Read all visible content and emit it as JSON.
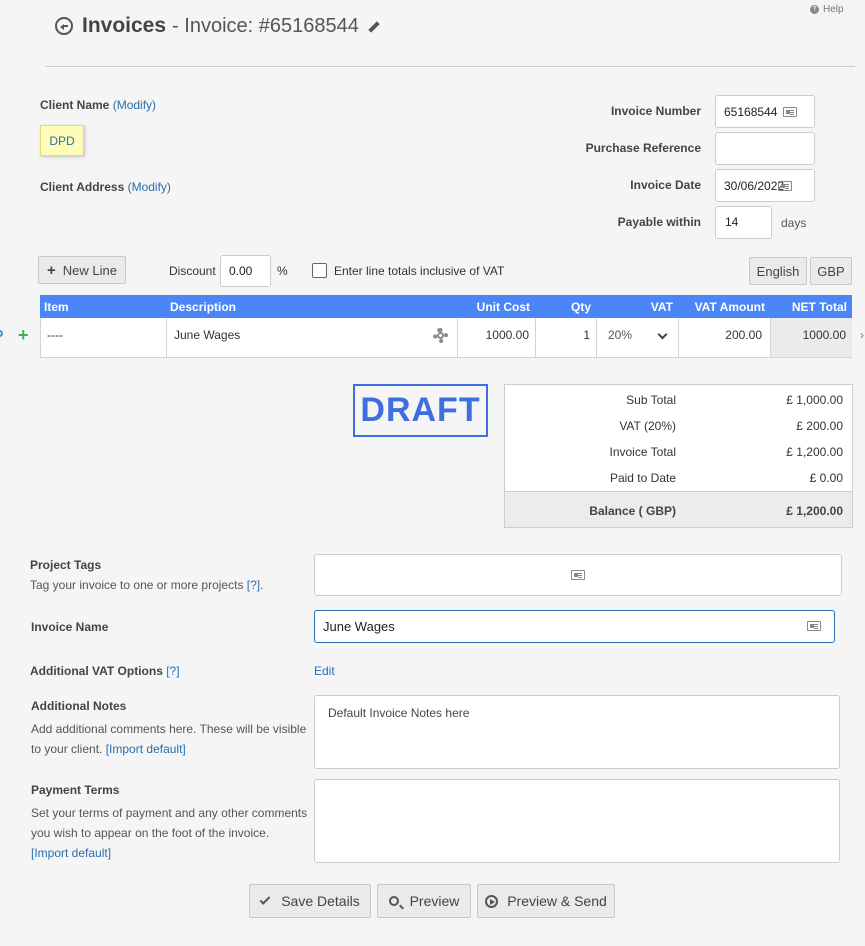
{
  "header": {
    "back_icon": "circle-arrow-left-icon",
    "title": "Invoices",
    "subtitle": "- Invoice: #65168544",
    "edit_icon": "pencil-icon",
    "help": "Help"
  },
  "client": {
    "name_label": "Client Name",
    "modify": "(Modify)",
    "name_value": "DPD",
    "address_label": "Client Address",
    "address_modify": "(Modify)"
  },
  "invoice_meta": {
    "number_label": "Invoice Number",
    "number_value": "65168544",
    "purchase_ref_label": "Purchase Reference",
    "purchase_ref_value": "",
    "date_label": "Invoice Date",
    "date_value": "30/06/2022",
    "payable_label": "Payable within",
    "payable_value": "14",
    "payable_unit": "days"
  },
  "toolbar": {
    "new_line": "New Line",
    "discount_label": "Discount",
    "discount_value": "0.00",
    "discount_unit": "%",
    "vat_inclusive_label": "Enter line totals inclusive of VAT",
    "language": "English",
    "currency": "GBP"
  },
  "table": {
    "headers": [
      "Item",
      "Description",
      "Unit Cost",
      "Qty",
      "VAT",
      "VAT Amount",
      "NET Total"
    ],
    "rows": [
      {
        "item": "----",
        "description": "June Wages",
        "unit_cost": "1000.00",
        "qty": "1",
        "vat": "20%",
        "vat_amount": "200.00",
        "net_total": "1000.00"
      }
    ]
  },
  "status_stamp": "DRAFT",
  "totals": {
    "sub_total_label": "Sub Total",
    "sub_total": "£ 1,000.00",
    "vat_label": "VAT (20%)",
    "vat": "£ 200.00",
    "invoice_total_label": "Invoice Total",
    "invoice_total": "£ 1,200.00",
    "paid_label": "Paid to Date",
    "paid": "£ 0.00",
    "balance_label": "Balance ( GBP)",
    "balance": "£ 1,200.00"
  },
  "project_tags": {
    "label": "Project Tags",
    "help": "Tag your invoice to one or more projects",
    "help_link": "[?]",
    "help_end": "."
  },
  "invoice_name": {
    "label": "Invoice Name",
    "value": "June Wages"
  },
  "vat_options": {
    "label": "Additional VAT Options",
    "help_link": "[?]",
    "edit": "Edit"
  },
  "notes": {
    "label": "Additional Notes",
    "help1": "Add additional comments here. These will be visible",
    "help2": "to your client.",
    "import": "[Import default]",
    "value": "Default Invoice Notes here"
  },
  "terms": {
    "label": "Payment Terms",
    "help1": "Set your terms of payment and any other comments",
    "help2": "you wish to appear on the foot of the invoice.",
    "import": "[Import default]",
    "value": ""
  },
  "actions": {
    "save": "Save Details",
    "preview": "Preview",
    "preview_send": "Preview & Send"
  }
}
